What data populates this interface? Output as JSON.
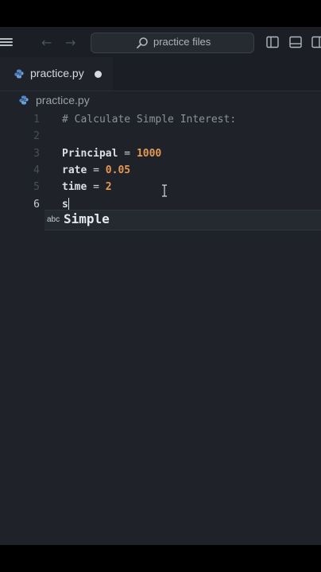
{
  "titlebar": {
    "search_text": "practice files"
  },
  "tab": {
    "label": "practice.py",
    "modified": true
  },
  "breadcrumb": {
    "label": "practice.py"
  },
  "editor": {
    "lines": [
      {
        "num": "1",
        "text": "# Calculate Simple Interest:"
      },
      {
        "num": "2",
        "text": ""
      },
      {
        "num": "3",
        "name": "Principal",
        "op": " = ",
        "value": "1000"
      },
      {
        "num": "4",
        "name": "rate",
        "op": " = ",
        "value": "0.05"
      },
      {
        "num": "5",
        "name": "time",
        "op": " = ",
        "value": "2"
      },
      {
        "num": "6",
        "text": "s"
      }
    ],
    "active_line": 6
  },
  "autocomplete": {
    "kind": "abc",
    "suggestion": "Simple"
  },
  "colors": {
    "editor_bg": "#1f2329",
    "number": "#e59953",
    "comment": "#8a929c",
    "python_icon": "#4f86c6"
  },
  "icons": [
    "menu-icon",
    "back-arrow-icon",
    "forward-arrow-icon",
    "search-icon",
    "python-file-icon",
    "split-editor-icon",
    "toggle-panel-icon",
    "layout-icon"
  ]
}
